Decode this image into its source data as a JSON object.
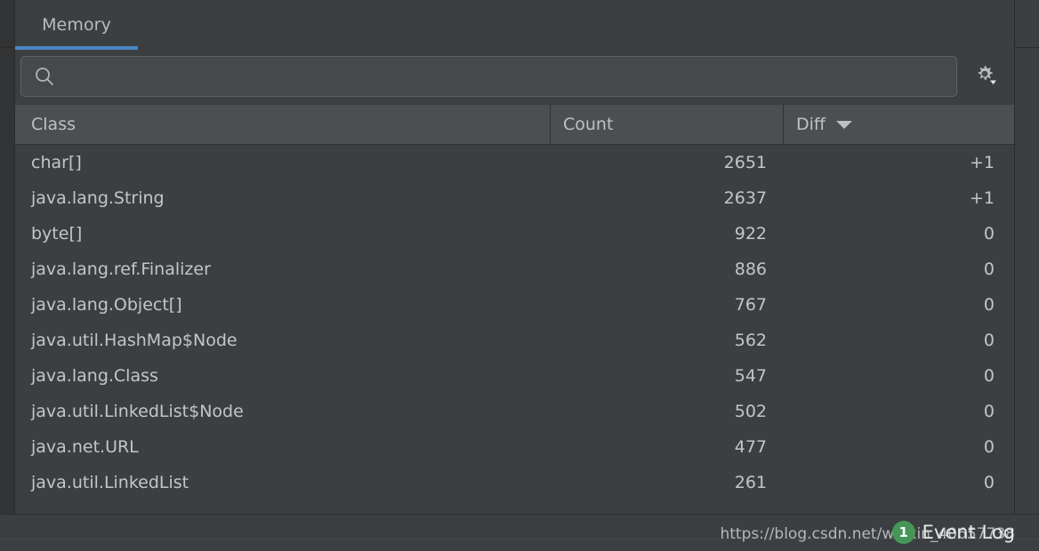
{
  "window": {
    "background": "#313335",
    "panel_background": "#3c3f41",
    "accent": "#4a88c7"
  },
  "tabs": [
    {
      "label": "Memory",
      "active": true
    }
  ],
  "search": {
    "value": "",
    "placeholder": "",
    "icon": "search-icon"
  },
  "toolbar": {
    "settings_icon": "gear-icon",
    "settings_tooltip": "Settings"
  },
  "table": {
    "columns": [
      {
        "key": "class",
        "label": "Class",
        "sorted": false
      },
      {
        "key": "count",
        "label": "Count",
        "sorted": false
      },
      {
        "key": "diff",
        "label": "Diff",
        "sorted": true,
        "sort_direction": "desc",
        "sort_icon": "triangle-down-icon"
      }
    ],
    "rows": [
      {
        "class": "char[]",
        "count": "2651",
        "diff": "+1"
      },
      {
        "class": "java.lang.String",
        "count": "2637",
        "diff": "+1"
      },
      {
        "class": "byte[]",
        "count": "922",
        "diff": "0"
      },
      {
        "class": "java.lang.ref.Finalizer",
        "count": "886",
        "diff": "0"
      },
      {
        "class": "java.lang.Object[]",
        "count": "767",
        "diff": "0"
      },
      {
        "class": "java.util.HashMap$Node",
        "count": "562",
        "diff": "0"
      },
      {
        "class": "java.lang.Class",
        "count": "547",
        "diff": "0"
      },
      {
        "class": "java.util.LinkedList$Node",
        "count": "502",
        "diff": "0"
      },
      {
        "class": "java.net.URL",
        "count": "477",
        "diff": "0"
      },
      {
        "class": "java.util.LinkedList",
        "count": "261",
        "diff": "0"
      }
    ]
  },
  "status_bar": {
    "event_log": {
      "label": "Event Log",
      "badge_count": "1",
      "badge_color": "#46965a"
    },
    "watermark": "https://blog.csdn.net/weixin_40657738"
  }
}
